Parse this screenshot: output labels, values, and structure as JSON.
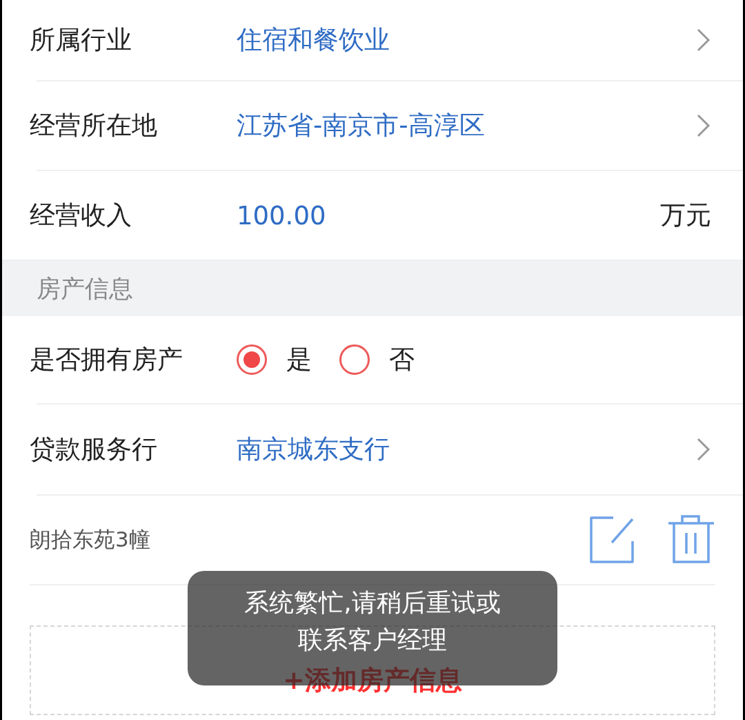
{
  "fields": [
    {
      "kind": "select",
      "label": "所属行业",
      "value": "住宿和餐饮业"
    },
    {
      "kind": "select",
      "label": "经营所在地",
      "value": "江苏省-南京市-高淳区"
    },
    {
      "kind": "amount",
      "label": "经营收入",
      "value": "100.00",
      "unit": "万元"
    }
  ],
  "section": {
    "title": "房产信息"
  },
  "property_fields": [
    {
      "kind": "radio",
      "label": "是否拥有房产",
      "options": [
        {
          "label": "是",
          "selected": true
        },
        {
          "label": "否",
          "selected": false
        }
      ]
    },
    {
      "kind": "select",
      "label": "贷款服务行",
      "value": "南京城东支行"
    }
  ],
  "properties": [
    {
      "name": "朗拾东苑3幢"
    }
  ],
  "add_button": {
    "label": "+添加房产信息"
  },
  "toast": {
    "message": "系统繁忙,请稍后重试或联系客户经理"
  }
}
